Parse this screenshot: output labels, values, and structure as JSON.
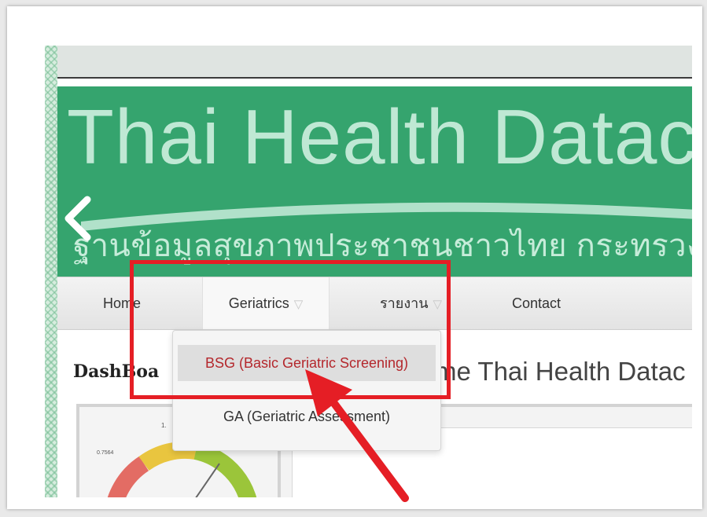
{
  "banner": {
    "title": "Thai Health Datace",
    "subtitle": "ฐานข้อมูลสุขภาพประชาชนชาวไทย กระทรวง"
  },
  "nav": {
    "items": [
      {
        "label": "Home"
      },
      {
        "label": "Geriatrics",
        "caret": "▽"
      },
      {
        "label": "รายงาน",
        "caret": "▽"
      },
      {
        "label": "Contact"
      }
    ]
  },
  "dropdown": {
    "items": [
      {
        "label": "BSG (Basic Geriatric Screening)"
      },
      {
        "label": "GA (Geriatric Assessment)"
      }
    ]
  },
  "content": {
    "title": "DashBoa",
    "welcome": "me Thai Health Datac"
  },
  "gauge": {
    "top_label": "1.",
    "left_label": "0.7564"
  },
  "icons": {
    "carousel_prev": "chevron-left-icon",
    "dropdown_caret": "caret-down-icon"
  },
  "colors": {
    "banner_green": "#35a46e",
    "annotation_red": "#e51e25",
    "dropdown_highlight_text": "#b4272c"
  }
}
